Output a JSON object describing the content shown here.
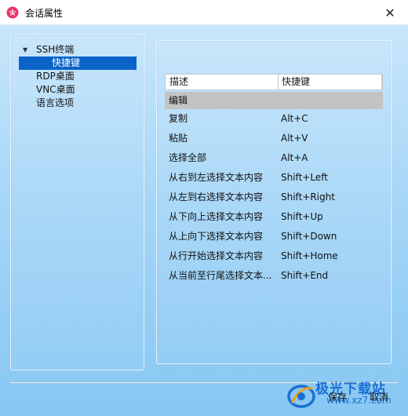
{
  "window": {
    "title": "会话属性",
    "close_symbol": "✕"
  },
  "tree": {
    "items": [
      {
        "label": "SSH终端",
        "expanded": true
      },
      {
        "label": "快捷键",
        "selected": true
      },
      {
        "label": "RDP桌面"
      },
      {
        "label": "VNC桌面"
      },
      {
        "label": "语言选项"
      }
    ],
    "expand_arrow": "▼"
  },
  "table": {
    "columns": [
      "描述",
      "快捷键"
    ],
    "group": "编辑",
    "rows": [
      {
        "desc": "复制",
        "key": "Alt+C"
      },
      {
        "desc": "粘贴",
        "key": "Alt+V"
      },
      {
        "desc": "选择全部",
        "key": "Alt+A"
      },
      {
        "desc": "从右到左选择文本内容",
        "key": "Shift+Left"
      },
      {
        "desc": "从左到右选择文本内容",
        "key": "Shift+Right"
      },
      {
        "desc": "从下向上选择文本内容",
        "key": "Shift+Up"
      },
      {
        "desc": "从上向下选择文本内容",
        "key": "Shift+Down"
      },
      {
        "desc": "从行开始选择文本内容",
        "key": "Shift+Home"
      },
      {
        "desc": "从当前至行尾选择文本...",
        "key": "Shift+End"
      }
    ]
  },
  "buttons": {
    "save": "保存",
    "cancel": "取消"
  },
  "watermark": {
    "brand": "极光下载站",
    "url": "www.xz7.com"
  },
  "colors": {
    "selection": "#0a64c8",
    "group_row": "#c3c3c3",
    "background_top": "#c8e6fb",
    "background_bottom": "#86c7f3"
  }
}
